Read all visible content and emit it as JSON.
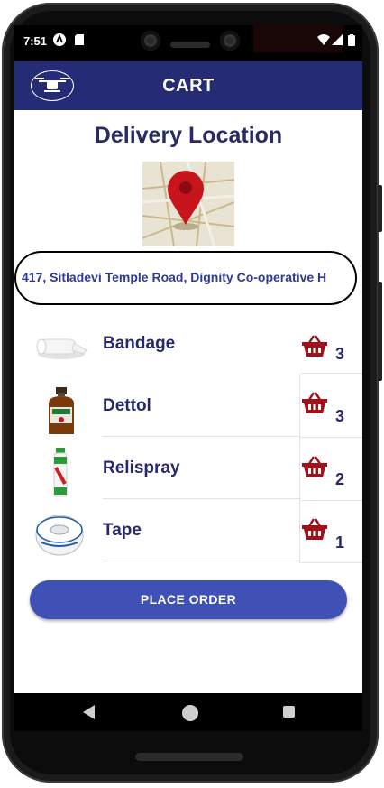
{
  "status_bar": {
    "time": "7:51"
  },
  "app_bar": {
    "title": "CART",
    "logo_icon": "drone-icon"
  },
  "delivery": {
    "heading": "Delivery Location",
    "address": "417, Sitladevi Temple Road, Dignity Co-operative H"
  },
  "items": [
    {
      "name": "Bandage",
      "qty": "3",
      "icon": "bandage-roll-icon"
    },
    {
      "name": "Dettol",
      "qty": "3",
      "icon": "antiseptic-bottle-icon"
    },
    {
      "name": "Relispray",
      "qty": "2",
      "icon": "spray-can-icon"
    },
    {
      "name": "Tape",
      "qty": "1",
      "icon": "tape-roll-icon"
    }
  ],
  "actions": {
    "place_order": "PLACE ORDER"
  },
  "colors": {
    "primary": "#262b75",
    "button": "#3f51b5",
    "basket": "#a0121a"
  }
}
